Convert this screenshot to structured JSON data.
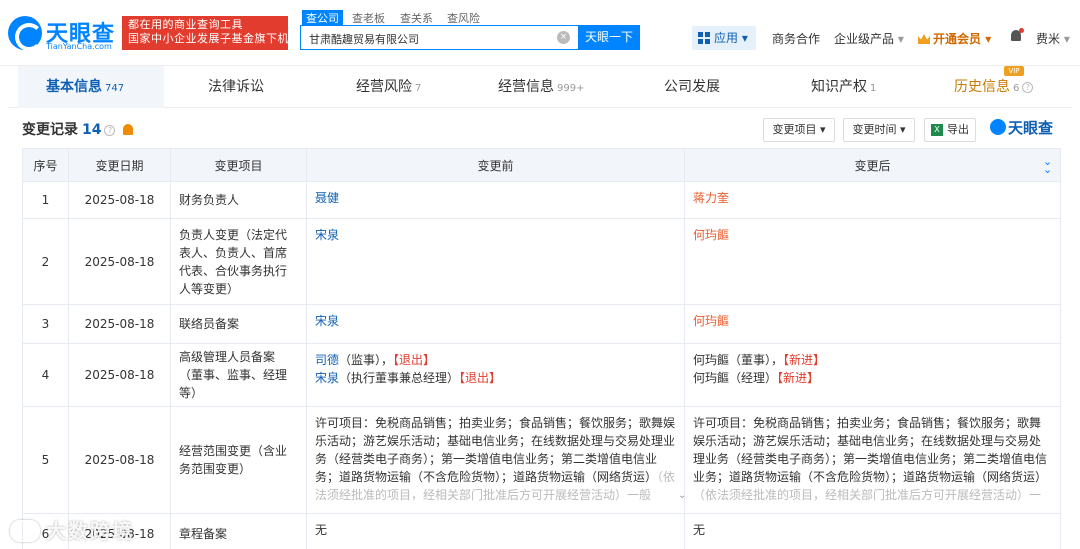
{
  "header": {
    "logo_text": "天眼查",
    "logo_sub": "TianYanCha.com",
    "slogan_line1": "都在用的商业查询工具",
    "slogan_line2": "国家中小企业发展子基金旗下机构",
    "search_tabs": [
      "查公司",
      "查老板",
      "查关系",
      "查风险"
    ],
    "search_value": "甘肃酷趣贸易有限公司",
    "search_button": "天眼一下",
    "nav_app": "应用",
    "nav_business": "商务合作",
    "nav_enterprise": "企业级产品",
    "nav_vip": "开通会员",
    "user_name": "费米"
  },
  "tabs": [
    {
      "label": "基本信息",
      "count": "747"
    },
    {
      "label": "法律诉讼",
      "count": ""
    },
    {
      "label": "经营风险",
      "count": "7"
    },
    {
      "label": "经营信息",
      "count": "999+"
    },
    {
      "label": "公司发展",
      "count": ""
    },
    {
      "label": "知识产权",
      "count": "1"
    },
    {
      "label": "历史信息",
      "count": "6"
    }
  ],
  "vip_badge": "VIP",
  "section": {
    "title": "变更记录",
    "count": "14",
    "filter_item": "变更项目",
    "filter_time": "变更时间",
    "export": "导出",
    "logo": "天眼查"
  },
  "table": {
    "headers": [
      "序号",
      "变更日期",
      "变更项目",
      "变更前",
      "变更后"
    ],
    "rows": [
      {
        "no": "1",
        "date": "2025-08-18",
        "item": "财务负责人",
        "before": [
          {
            "name": "聂健",
            "note": "",
            "tag": ""
          }
        ],
        "after": [
          {
            "name": "蒋力奎",
            "note": "",
            "tag": ""
          }
        ]
      },
      {
        "no": "2",
        "date": "2025-08-18",
        "item": "负责人变更（法定代表人、负责人、首席代表、合伙事务执行人等变更）",
        "before": [
          {
            "name": "宋泉",
            "note": "",
            "tag": ""
          }
        ],
        "after": [
          {
            "name": "何玙饇",
            "note": "",
            "tag": ""
          }
        ]
      },
      {
        "no": "3",
        "date": "2025-08-18",
        "item": "联络员备案",
        "before": [
          {
            "name": "宋泉",
            "note": "",
            "tag": ""
          }
        ],
        "after": [
          {
            "name": "何玙饇",
            "note": "",
            "tag": ""
          }
        ]
      },
      {
        "no": "4",
        "date": "2025-08-18",
        "item": "高级管理人员备案（董事、监事、经理等）",
        "before": [
          {
            "name": "司德",
            "note": "（监事），",
            "tag": "【退出】"
          },
          {
            "name": "宋泉",
            "note": "（执行董事兼总经理）",
            "tag": "【退出】"
          }
        ],
        "after": [
          {
            "name": "何玙饇",
            "note": "（董事），",
            "tag": "【新进】"
          },
          {
            "name": "何玙饇",
            "note": "（经理）",
            "tag": "【新进】"
          }
        ]
      },
      {
        "no": "5",
        "date": "2025-08-18",
        "item": "经营范围变更（含业务范围变更）",
        "before_text": "许可项目：免税商品销售；拍卖业务；食品销售；餐饮服务；歌舞娱乐活动；游艺娱乐活动；基础电信业务；在线数据处理与交易处理业务（经营类电子商务）；第一类增值电信业务；第二类增值电信业务；道路货物运输（不含危险货物）；道路货物运输（网络货运）",
        "before_fade": "（依法须经批准的项目，经相关部门批准后方可开展经营活动）一般",
        "after_text": "许可项目：免税商品销售；拍卖业务；食品销售；餐饮服务；歌舞娱乐活动；游艺娱乐活动；基础电信业务；在线数据处理与交易处理业务（经营类电子商务）；第一类增值电信业务；第二类增值电信业务；道路货物运输（不含危险货物）；道路货物运输（网络货运）",
        "after_fade": "（依法须经批准的项目，经相关部门批准后方可开展经营活动）一般"
      },
      {
        "no": "6",
        "date": "2025-08-18",
        "item": "章程备案",
        "before_text": "无",
        "after_text": "无"
      }
    ]
  },
  "watermark": "大数跨境"
}
